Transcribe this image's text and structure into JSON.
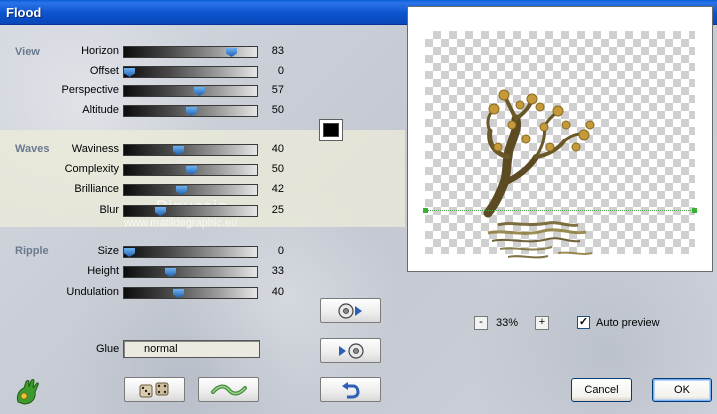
{
  "window": {
    "title": "Flood"
  },
  "sections": {
    "view": "View",
    "waves": "Waves",
    "ripple": "Ripple"
  },
  "params": [
    {
      "label": "Horizon",
      "value": 83,
      "fraction": 0.83
    },
    {
      "label": "Offset",
      "value": 0,
      "fraction": 0.0
    },
    {
      "label": "Perspective",
      "value": 57,
      "fraction": 0.57
    },
    {
      "label": "Altitude",
      "value": 50,
      "fraction": 0.5
    },
    {
      "label": "Waviness",
      "value": 40,
      "fraction": 0.4
    },
    {
      "label": "Complexity",
      "value": 50,
      "fraction": 0.5
    },
    {
      "label": "Brilliance",
      "value": 42,
      "fraction": 0.42
    },
    {
      "label": "Blur",
      "value": 25,
      "fraction": 0.25
    },
    {
      "label": "Size",
      "value": 0,
      "fraction": 0.0
    },
    {
      "label": "Height",
      "value": 33,
      "fraction": 0.33
    },
    {
      "label": "Undulation",
      "value": 40,
      "fraction": 0.4
    }
  ],
  "color_swatch": "#000000",
  "watermark": {
    "name": "Pinuccia",
    "site": "www.matildegraphic.eu"
  },
  "glue": {
    "label": "Glue",
    "value": "normal"
  },
  "zoom": {
    "minus": "-",
    "level": "33%",
    "plus": "+"
  },
  "auto_preview": {
    "label": "Auto preview",
    "checked": true,
    "mark": "✓"
  },
  "buttons": {
    "cancel": "Cancel",
    "ok": "OK"
  },
  "icons": {
    "app": "plugin-hand-icon",
    "randomize": "dice-icon",
    "reset": "wave-icon",
    "load_preset": "disc-load-icon",
    "save_preset": "disc-save-icon",
    "undo": "undo-arrow-icon"
  },
  "colors": {
    "titlebar": "#0c54cf",
    "thumb": "#1d5fb0",
    "section_label": "#6a7a8e",
    "waves_band": "#ececd8"
  }
}
